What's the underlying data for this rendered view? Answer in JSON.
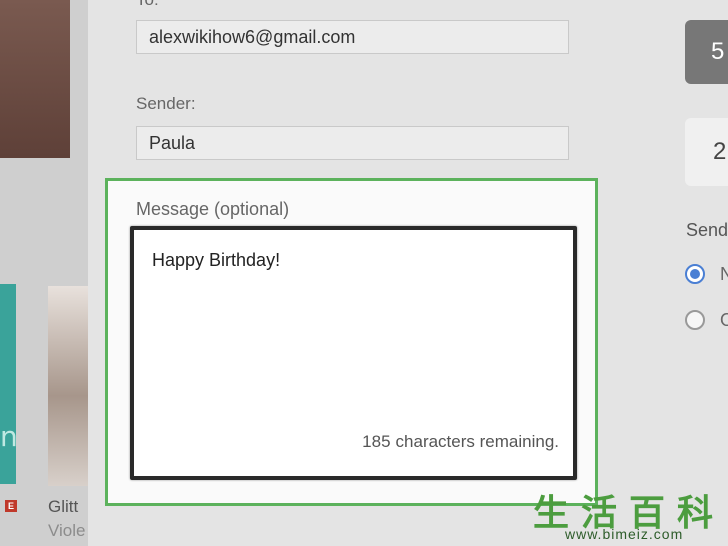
{
  "form": {
    "to_label": "To:",
    "to_value": "alexwikihow6@gmail.com",
    "sender_label": "Sender:",
    "sender_value": "Paula",
    "message_label": "Message (optional)",
    "message_value": "Happy Birthday!",
    "remaining_count": "185",
    "remaining_suffix": "characters remaining."
  },
  "right": {
    "amount_1": "5",
    "amount_2": "2",
    "send_label": "Send",
    "radio_1": "N",
    "radio_2": "O"
  },
  "left": {
    "teal_letter": "n",
    "badge": "E",
    "product_title": "Glitt",
    "product_sub": "Viole"
  },
  "watermark": {
    "chinese": "生活百科",
    "url": "www.bimeiz.com"
  },
  "colors": {
    "accent_green": "#5cb25c",
    "radio_blue": "#4a7fd4"
  }
}
